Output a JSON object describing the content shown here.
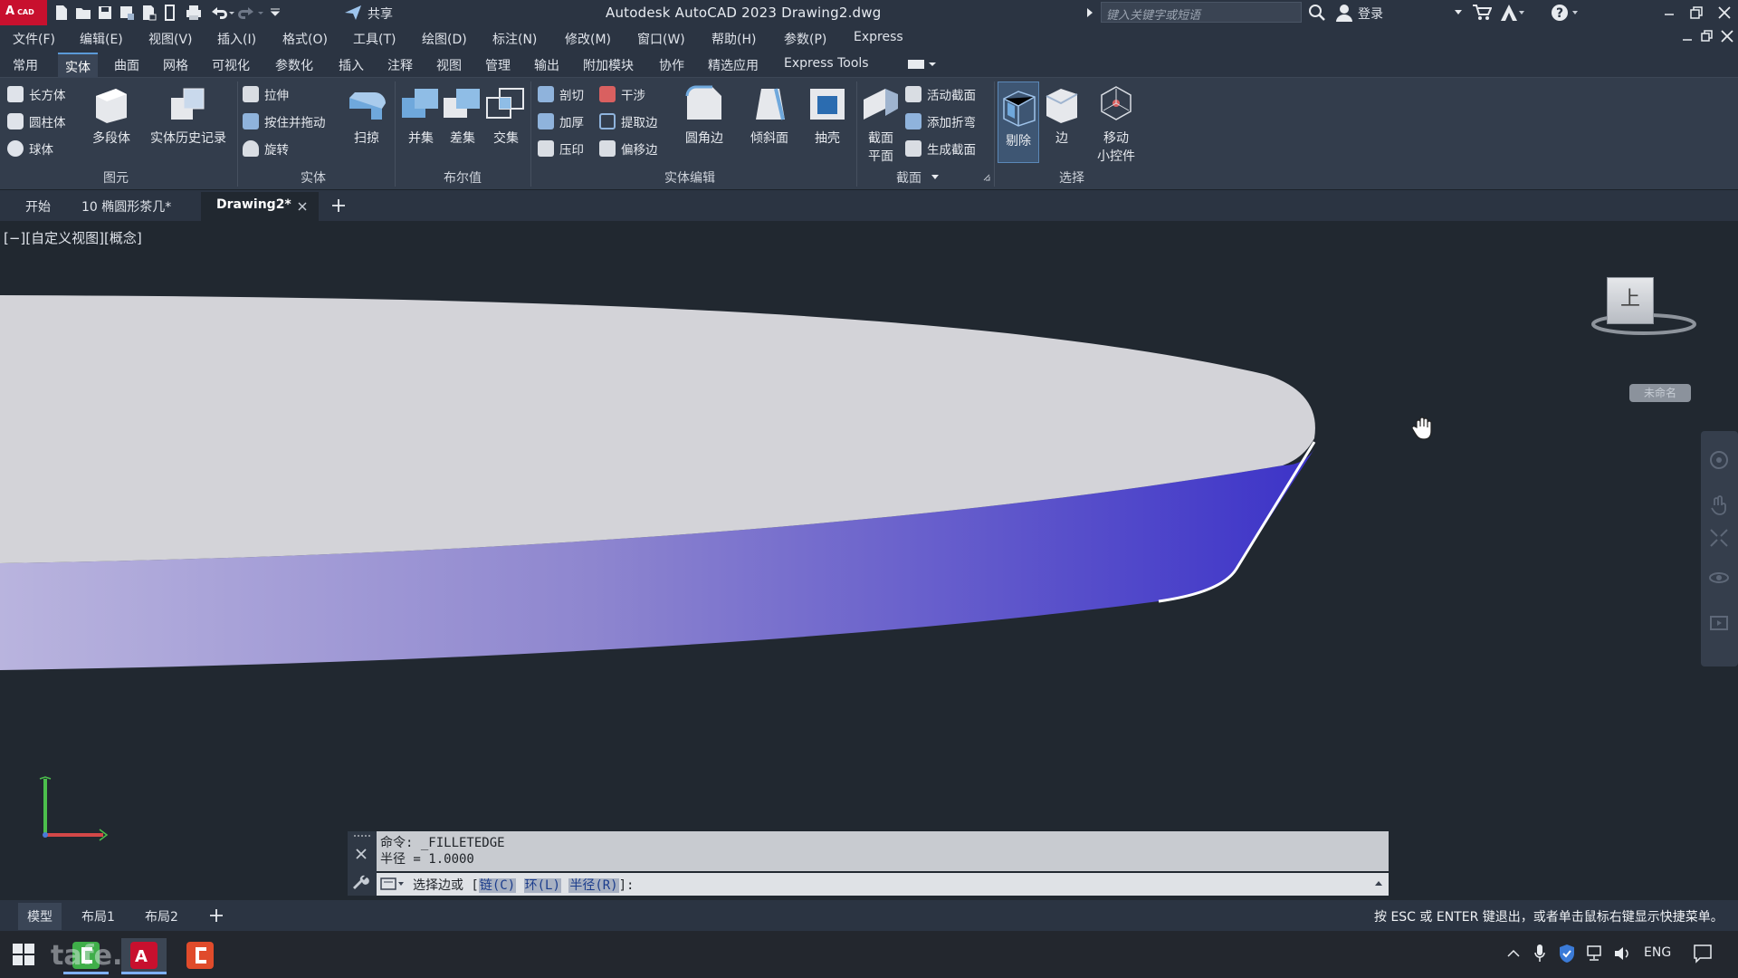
{
  "titlebar": {
    "logo_text": "A",
    "logo_sub": "CAD",
    "share_label": "共享",
    "app_title": "Autodesk AutoCAD 2023    Drawing2.dwg",
    "search_placeholder": "键入关键字或短语",
    "login_label": "登录"
  },
  "menu": [
    "文件(F)",
    "编辑(E)",
    "视图(V)",
    "插入(I)",
    "格式(O)",
    "工具(T)",
    "绘图(D)",
    "标注(N)",
    "修改(M)",
    "窗口(W)",
    "帮助(H)",
    "参数(P)",
    "Express"
  ],
  "ribbon_tabs": [
    "常用",
    "实体",
    "曲面",
    "网格",
    "可视化",
    "参数化",
    "插入",
    "注释",
    "视图",
    "管理",
    "输出",
    "附加模块",
    "协作",
    "精选应用",
    "Express Tools"
  ],
  "ribbon_active_tab": "实体",
  "ribbon": {
    "primitive": {
      "box": "长方体",
      "cylinder": "圆柱体",
      "sphere": "球体",
      "polysolid": "多段体",
      "history": "实体历史记录",
      "group": "图元"
    },
    "solid": {
      "extrude": "拉伸",
      "presspull": "按住并拖动",
      "revolve": "旋转",
      "sweep": "扫掠",
      "group": "实体"
    },
    "boolean": {
      "union": "并集",
      "subtract": "差集",
      "intersect": "交集",
      "group": "布尔值"
    },
    "solid_edit": {
      "slice": "剖切",
      "interfere": "干涉",
      "thicken": "加厚",
      "extract_edges": "提取边",
      "imprint": "压印",
      "offset_edge": "偏移边",
      "fillet_edge": "圆角边",
      "taper": "倾斜面",
      "shell": "抽壳",
      "group": "实体编辑"
    },
    "section": {
      "plane_line1": "截面",
      "plane_line2": "平面",
      "live": "活动截面",
      "jog": "添加折弯",
      "generate": "生成截面",
      "group": "截面"
    },
    "selection": {
      "cull": "剔除",
      "edge": "边",
      "gizmo_line1": "移动",
      "gizmo_line2": "小控件",
      "group": "选择"
    }
  },
  "file_tabs": [
    "开始",
    "10 椭圆形茶几*",
    "Drawing2*"
  ],
  "active_file_tab": "Drawing2*",
  "viewport": {
    "view_label": "[−][自定义视图][概念]",
    "viewcube_face": "上",
    "wcs_label": "未命名"
  },
  "command": {
    "history_line1": "命令: _FILLETEDGE",
    "history_line2": "半径 = 1.0000",
    "prompt_prefix": "选择边或 [",
    "opt_chain": "链(C)",
    "opt_loop": "环(L)",
    "opt_radius": "半径(R)",
    "prompt_suffix": "]:"
  },
  "layout_tabs": [
    "模型",
    "布局1",
    "布局2"
  ],
  "status_message": "按 ESC 或 ENTER 键退出，或者单击鼠标右键显示快捷菜单。",
  "taskbar": {
    "watermark": "tafe.cc",
    "language": "ENG"
  },
  "colors": {
    "solid_side": "#5a4fcf",
    "solid_top": "#d3d3d8",
    "accent": "#5b9ad8",
    "logo": "#c8102e"
  }
}
